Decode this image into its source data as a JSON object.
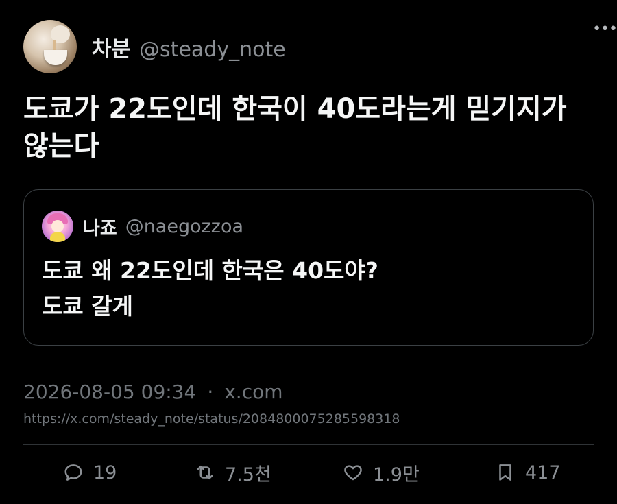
{
  "author": {
    "display_name": "차분",
    "handle": "@steady_note"
  },
  "more_label": "•••",
  "tweet_text_line1": "도쿄가 22도인데 한국이 40도라는게 믿기지가",
  "tweet_text_line2": "않는다",
  "quote": {
    "display_name": "나죠",
    "handle": "@naegozzoa",
    "text_line1": "도쿄 왜 22도인데 한국은 40도야?",
    "text_line2": "도쿄 갈게"
  },
  "meta": {
    "timestamp": "2026-08-05 09:34",
    "separator": "·",
    "source": "x.com"
  },
  "url": "https://x.com/steady_note/status/2084800075285598318",
  "actions": {
    "replies": "19",
    "reposts": "7.5천",
    "likes": "1.9만",
    "bookmarks": "417"
  },
  "icons": {
    "reply": "reply-icon",
    "repost": "repost-icon",
    "like": "heart-icon",
    "bookmark": "bookmark-icon"
  }
}
